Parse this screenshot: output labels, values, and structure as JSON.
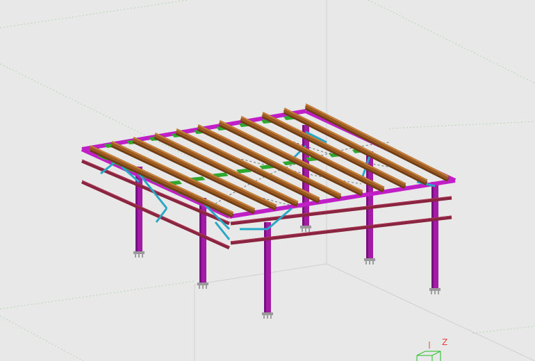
{
  "viewport": {
    "background": "#e8e8e8",
    "grid_color": "#a9c9a9",
    "grid_line_color": "#cfcfcf"
  },
  "structure": {
    "description_colors": {
      "column": "#a21ca6",
      "column_dark": "#7a0f80",
      "roof_beam": "#9a5a22",
      "roof_beam_top": "#c8823a",
      "primary_beam": "#c01fc8",
      "secondary_beam": "#8a2540",
      "deck_panel": "#2fa82f",
      "bracing": "#29a7c6",
      "baseplate": "#9a9a9a"
    }
  },
  "axis_gizmo": {
    "icon": "view-cube-axis-icon",
    "z_label": "Z",
    "z_color": "#e84040",
    "cube_color": "#22c022"
  }
}
